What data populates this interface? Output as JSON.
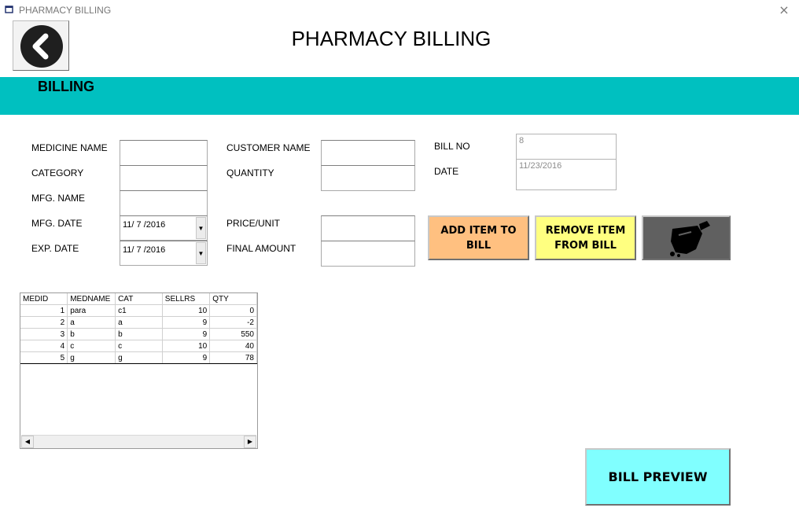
{
  "window": {
    "title": "PHARMACY BILLING",
    "close_glyph": "×"
  },
  "header": {
    "title": "PHARMACY BILLING",
    "back_icon": "back-arrow-icon"
  },
  "section": {
    "title": "BILLING",
    "color": "#00c0c0"
  },
  "form": {
    "medicine_name_label": "MEDICINE NAME",
    "category_label": "CATEGORY",
    "mfg_name_label": "MFG. NAME",
    "mfg_date_label": "MFG. DATE",
    "mfg_date_value": "11/ 7 /2016",
    "exp_date_label": "EXP. DATE",
    "exp_date_value": "11/ 7 /2016",
    "customer_name_label": "CUSTOMER NAME",
    "quantity_label": "QUANTITY",
    "price_unit_label": "PRICE/UNIT",
    "final_amount_label": "FINAL AMOUNT",
    "bill_no_label": "BILL NO",
    "bill_no_value": "8",
    "date_label": "DATE",
    "date_value": "11/23/2016"
  },
  "buttons": {
    "add_item": "ADD ITEM TO BILL",
    "remove_item": "REMOVE ITEM FROM BILL",
    "clear_icon": "broom-icon",
    "bill_preview": "BILL PREVIEW",
    "add_color": "#ffc080",
    "remove_color": "#ffff80",
    "preview_color": "#80ffff"
  },
  "table": {
    "columns": [
      "MEDID",
      "MEDNAME",
      "CAT",
      "SELLRS",
      "QTY"
    ],
    "rows": [
      [
        "1",
        "para",
        "c1",
        "10",
        "0"
      ],
      [
        "2",
        "a",
        "a",
        "9",
        "-2"
      ],
      [
        "3",
        "b",
        "b",
        "9",
        "550"
      ],
      [
        "4",
        "c",
        "c",
        "10",
        "40"
      ],
      [
        "5",
        "g",
        "g",
        "9",
        "78"
      ]
    ],
    "scroll_left": "◀",
    "scroll_right": "▶"
  }
}
